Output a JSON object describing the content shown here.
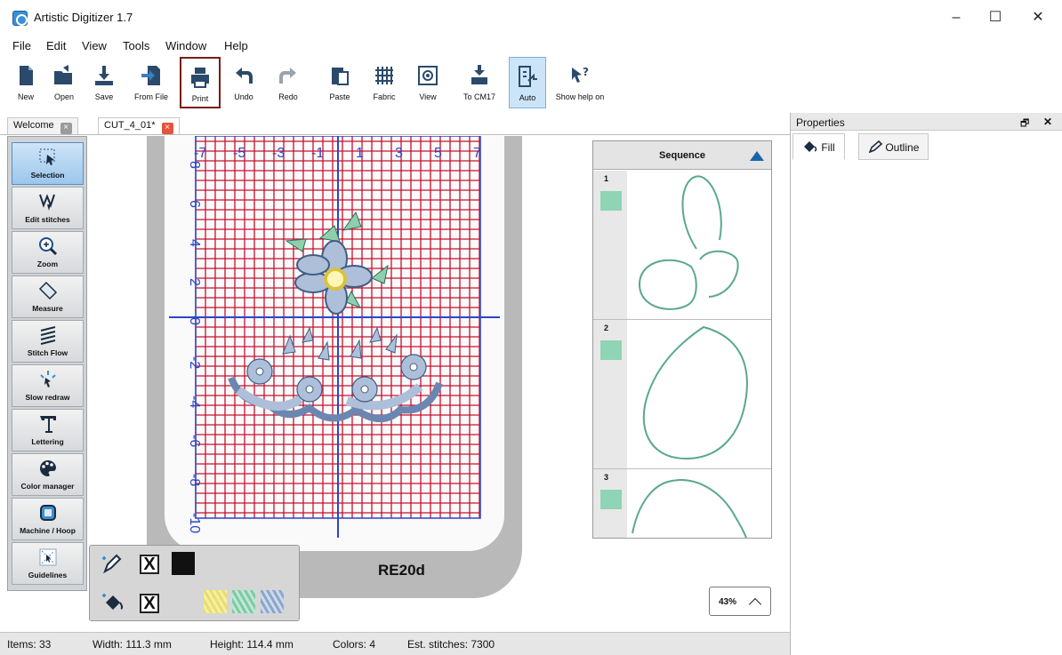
{
  "window": {
    "title": "Artistic Digitizer 1.7",
    "minimize": "–",
    "maximize": "☐",
    "close": "✕"
  },
  "menu": [
    "File",
    "Edit",
    "View",
    "Tools",
    "Window",
    "Help"
  ],
  "toolbar": {
    "new": "New",
    "open": "Open",
    "save": "Save",
    "from_file": "From File",
    "print": "Print",
    "undo": "Undo",
    "redo": "Redo",
    "paste": "Paste",
    "fabric": "Fabric",
    "view": "View",
    "to_cm": "To CM17",
    "auto": "Auto",
    "help": "Show help on"
  },
  "tabs": [
    {
      "label": "Welcome",
      "close": "×"
    },
    {
      "label": "CUT_4_01*",
      "close": "×"
    }
  ],
  "tools": [
    "Selection",
    "Edit stitches",
    "Zoom",
    "Measure",
    "Stitch Flow",
    "Slow redraw",
    "Lettering",
    "Color manager",
    "Machine / Hoop",
    "Guidelines"
  ],
  "ruler": {
    "x_labels": [
      "-7",
      "-5",
      "-3",
      "-1",
      "1",
      "3",
      "5",
      "7"
    ],
    "y_labels": [
      "8",
      "6",
      "4",
      "2",
      "0",
      "-2",
      "-4",
      "-6",
      "-8",
      "-10"
    ]
  },
  "hoop": {
    "label": "RE20d"
  },
  "sequence": {
    "title": "Sequence",
    "items": [
      "1",
      "2",
      "3"
    ],
    "thread_color": "#8fd4b5"
  },
  "zoom": {
    "value": "43%"
  },
  "color_panel": {
    "outline_mark": "X",
    "fill_mark": "X",
    "colors": [
      "#111111",
      "#e8dd72",
      "#9fd9bf",
      "#a9bed8"
    ]
  },
  "status": {
    "items": "Items: 33",
    "width": "Width: 111.3 mm",
    "height": "Height: 114.4 mm",
    "colors": "Colors: 4",
    "stitches": "Est. stitches: 7300"
  },
  "properties": {
    "title": "Properties",
    "pin": "🗗",
    "close": "✕",
    "fill_tab": "Fill",
    "outline_tab": "Outline"
  },
  "accent": {
    "grid": "#c8102e",
    "axis": "#2b45c7",
    "print_highlight": "#7a1b1b",
    "tab_close": "#e5533d"
  }
}
